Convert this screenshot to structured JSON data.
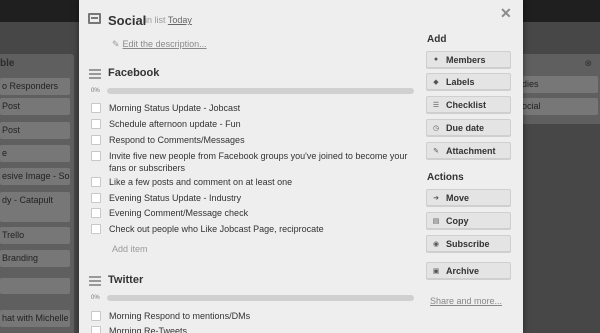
{
  "board": {
    "left_list": {
      "title": "ble",
      "cards": [
        "o Responders",
        "Post",
        "Post",
        "e",
        "esive Image - Social",
        "dy - Catapult",
        "Trello",
        "Branding",
        "",
        "hat with Michelle"
      ]
    },
    "right_list": {
      "cards": [
        "dies",
        "ocial"
      ]
    }
  },
  "card": {
    "title": "Social",
    "in_list_prefix": "in list",
    "list_name": "Today",
    "edit_description": "Edit the description...",
    "close_symbol": "✕"
  },
  "checklists": [
    {
      "title": "Facebook",
      "progress_label": "0%",
      "progress": 0,
      "items": [
        "Morning Status Update - Jobcast",
        "Schedule afternoon update - Fun",
        "Respond to Comments/Messages",
        "Invite five new people from Facebook groups you've joined to become your fans or subscribers",
        "Like a few posts and comment on at least one",
        "Evening Status Update - Industry",
        "Evening Comment/Message check",
        "Check out people who Like Jobcast Page, reciprocate"
      ],
      "add_item": "Add item"
    },
    {
      "title": "Twitter",
      "progress_label": "0%",
      "progress": 0,
      "items": [
        "Morning Respond to mentions/DMs",
        "Morning Re-Tweets"
      ]
    }
  ],
  "sidebar": {
    "add_heading": "Add",
    "add_buttons": [
      {
        "label": "Members",
        "icon": "person-icon"
      },
      {
        "label": "Labels",
        "icon": "tag-icon"
      },
      {
        "label": "Checklist",
        "icon": "checklist-icon"
      },
      {
        "label": "Due date",
        "icon": "clock-icon"
      },
      {
        "label": "Attachment",
        "icon": "paperclip-icon"
      }
    ],
    "actions_heading": "Actions",
    "action_buttons": [
      {
        "label": "Move",
        "icon": "arrow-right-icon"
      },
      {
        "label": "Copy",
        "icon": "copy-icon"
      },
      {
        "label": "Subscribe",
        "icon": "eye-icon"
      },
      {
        "label": "Archive",
        "icon": "archive-icon"
      }
    ],
    "share_link": "Share and more..."
  }
}
